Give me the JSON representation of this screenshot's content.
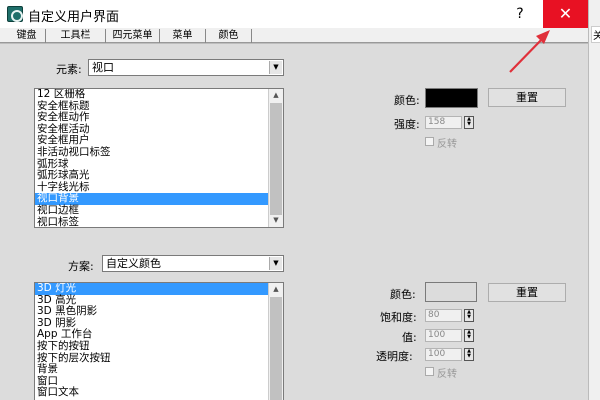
{
  "window": {
    "title": "自定义用户界面",
    "help_label": "?",
    "close_label": "✕",
    "edge_char": "关"
  },
  "tabs": [
    {
      "label": "键盘"
    },
    {
      "label": "工具栏"
    },
    {
      "label": "四元菜单"
    },
    {
      "label": "菜单"
    },
    {
      "label": "颜色"
    }
  ],
  "elements_section": {
    "label": "元素:",
    "selected": "视口",
    "items": [
      "12 区栅格",
      "安全框标题",
      "安全框动作",
      "安全框活动",
      "安全框用户",
      "非活动视口标签",
      "弧形球",
      "弧形球高光",
      "十字线光标",
      "视口背景",
      "视口边框",
      "视口标签"
    ],
    "selected_index": 9,
    "color_label": "颜色:",
    "color_value": "#000000",
    "reset_label": "重置",
    "intensity_label": "强度:",
    "intensity_value": "158",
    "invert_label": "反转"
  },
  "scheme_section": {
    "label": "方案:",
    "selected": "自定义颜色",
    "items": [
      "3D 灯光",
      "3D 高光",
      "3D 黑色阴影",
      "3D 阴影",
      "App 工作台",
      "按下的按钮",
      "按下的层次按钮",
      "背景",
      "窗口",
      "窗口文本"
    ],
    "selected_index": 0,
    "color_label": "颜色:",
    "color_value": "#dcdcdc",
    "reset_label": "重置",
    "saturation_label": "饱和度:",
    "saturation_value": "80",
    "value_label": "值:",
    "value_value": "100",
    "transparency_label": "透明度:",
    "transparency_value": "100",
    "invert_label": "反转"
  },
  "colors": {
    "accent_close": "#e81123",
    "selection": "#3399ff",
    "annotation_arrow": "#e0303a"
  }
}
